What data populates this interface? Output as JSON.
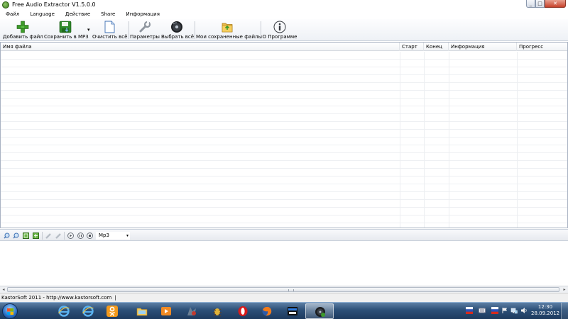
{
  "window": {
    "title": "Free Audio Extractor V1.5.0.0",
    "controls": {
      "minimize": "_",
      "maximize": "□",
      "close": "✕"
    }
  },
  "menu": [
    "Файл",
    "Language",
    "Действие",
    "Share",
    "Информация"
  ],
  "toolbar": {
    "add_file": "Добавить файл",
    "save_mp3": "Сохранить в MP3",
    "clear_all": "Очистить всё",
    "settings": "Параметры",
    "select_all": "Выбрать всё",
    "my_saved_files": "Мои сохраненные файлы",
    "about": "О Программе",
    "dropdown_glyph": "▾"
  },
  "list": {
    "columns": [
      "Имя файла",
      "Старт",
      "Конец",
      "Информация",
      "Прогресс"
    ]
  },
  "player": {
    "format": "Mp3",
    "icons": [
      "zoom-in-icon",
      "zoom-out-icon",
      "fit-icon",
      "expand-icon",
      "mark-in-icon",
      "mark-out-icon",
      "play-icon",
      "pause-icon",
      "stop-icon"
    ]
  },
  "status": {
    "text": "KastorSoft 2011 - http://www.kastorsoft.com"
  },
  "taskbar": {
    "apps": [
      "ie-icon",
      "ie-icon",
      "odnoklassniki-icon",
      "explorer-icon",
      "media-player-icon",
      "game-icon",
      "bug-icon",
      "opera-icon",
      "firefox-icon",
      "game-box-icon",
      "audio-extractor-icon"
    ],
    "clock_time": "12:30",
    "clock_date": "28.09.2012"
  },
  "colors": {
    "taskbar": "#2c4f77",
    "toolbar_bg": "#eef1f6",
    "accent_green": "#3d9b2a"
  }
}
